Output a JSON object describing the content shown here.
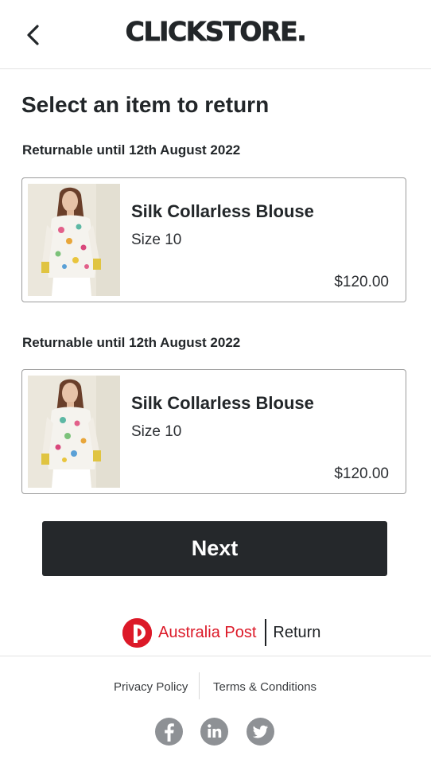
{
  "header": {
    "logo_text": "CLICKSTORE.",
    "back_icon": "chevron-left-icon"
  },
  "page": {
    "title": "Select an item to return"
  },
  "items": [
    {
      "returnable_text": "Returnable until 12th August 2022",
      "name": "Silk Collarless Blouse",
      "size": "Size 10",
      "price": "$120.00"
    },
    {
      "returnable_text": "Returnable until 12th August 2022",
      "name": "Silk Collarless Blouse",
      "size": "Size 10",
      "price": "$120.00"
    }
  ],
  "actions": {
    "next_label": "Next"
  },
  "partner": {
    "name": "Australia Post",
    "service": "Return",
    "brand_color": "#dc1928"
  },
  "footer": {
    "privacy_label": "Privacy Policy",
    "terms_label": "Terms & Conditions",
    "social_icons": [
      "facebook-icon",
      "linkedin-icon",
      "twitter-icon"
    ]
  },
  "colors": {
    "primary_button": "#25282b",
    "text": "#222629",
    "social_icon_bg": "#8e9195"
  }
}
